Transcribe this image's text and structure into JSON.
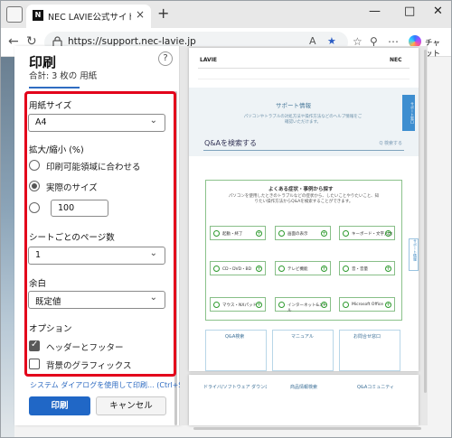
{
  "browser": {
    "tab_title": "NEC LAVIE公式サイト > サービス&サ",
    "tab_close": "×",
    "new_tab": "+",
    "url": "https://support.nec-lavie.jp",
    "copilot_label": "チャット",
    "window_controls": {
      "minimize": "—",
      "maximize": "□",
      "close": "✕"
    }
  },
  "print": {
    "title": "印刷",
    "subtitle": "合計: 3 枚の 用紙",
    "help": "?",
    "paper_size_label": "用紙サイズ",
    "paper_size_value": "A4",
    "scale_label": "拡大/縮小 (%)",
    "scale_options": [
      "印刷可能領域に合わせる",
      "実際のサイズ"
    ],
    "scale_custom_value": "100",
    "pages_per_sheet_label": "シートごとのページ数",
    "pages_per_sheet_value": "1",
    "margins_label": "余白",
    "margins_value": "既定値",
    "options_label": "オプション",
    "option_headers_footers": "ヘッダーとフッター",
    "option_background_graphics": "背景のグラフィックス",
    "system_dialog_link": "システム ダイアログを使用して印刷... (Ctrl+Shift+P)",
    "print_button": "印刷",
    "cancel_button": "キャンセル",
    "chevron": "⌄"
  },
  "preview": {
    "logo": "LAVIE",
    "brand": "NEC",
    "hero_title": "サポート情報",
    "hero_desc": "パソコンやトラブルの対処方法や操作方法などのヘルプ情報をご確認いただけます。",
    "search_placeholder": "Q&Aを検索する",
    "search_button": "Q 検索する",
    "side_tab": "サポート窓口",
    "side_tab2": "サポート情報",
    "faq_title": "よくある症状・事例から探す",
    "faq_desc": "パソコンを使用したときのトラブルなどの症状から、したいことやりたいこと、知りたい操作方法からQ&Aを検索することができます。",
    "faq_buttons": [
      "起動・終了",
      "画面の表示",
      "キーボード・文字入力",
      "CD・DVD・BD",
      "テレビ機能",
      "音・音量",
      "マウス・NXパッド",
      "インターネット&メール",
      "Microsoft Office"
    ],
    "bottom_cards": [
      "Q&A検索",
      "マニュアル",
      "お問合せ窓口"
    ],
    "bottom_cards2": [
      "ドライバ/ソフトウェア ダウンロード",
      "商品情報検索",
      "Q&Aコミュニティ"
    ]
  }
}
